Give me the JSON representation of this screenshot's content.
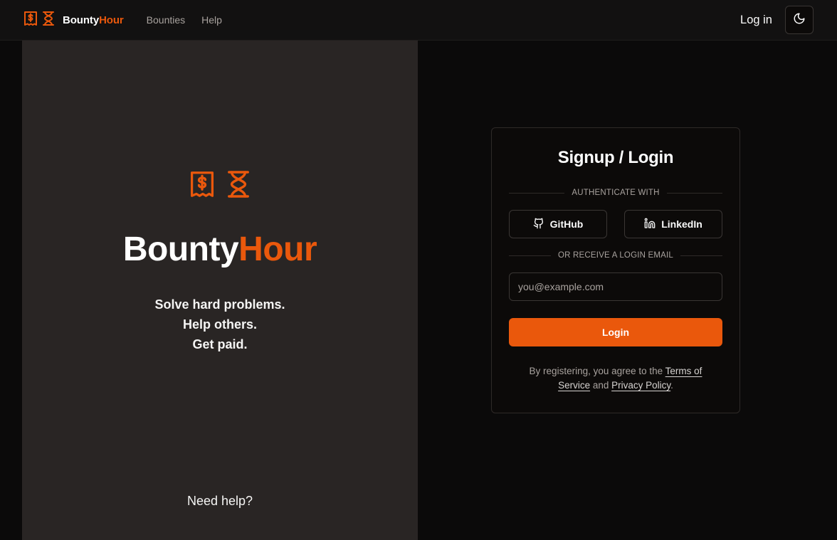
{
  "nav": {
    "brand_part1": "Bounty",
    "brand_part2": "Hour",
    "links": [
      "Bounties",
      "Help"
    ],
    "login": "Log in"
  },
  "hero": {
    "title_part1": "Bounty",
    "title_part2": "Hour",
    "tagline": [
      "Solve hard problems.",
      "Help others.",
      "Get paid."
    ],
    "help": "Need help?"
  },
  "auth": {
    "title": "Signup / Login",
    "divider1": "AUTHENTICATE WITH",
    "github": "GitHub",
    "linkedin": "LinkedIn",
    "divider2": "OR RECEIVE A LOGIN EMAIL",
    "email_placeholder": "you@example.com",
    "login_button": "Login",
    "terms_prefix": "By registering, you agree to the ",
    "terms_link": "Terms of Service",
    "terms_and": " and ",
    "privacy_link": "Privacy Policy",
    "terms_suffix": "."
  },
  "colors": {
    "accent": "#ea580c",
    "panel": "#292524",
    "background": "#0b0a0a"
  },
  "icons": [
    "receipt-dollar-icon",
    "hourglass-icon",
    "moon-icon",
    "github-icon",
    "linkedin-icon"
  ]
}
